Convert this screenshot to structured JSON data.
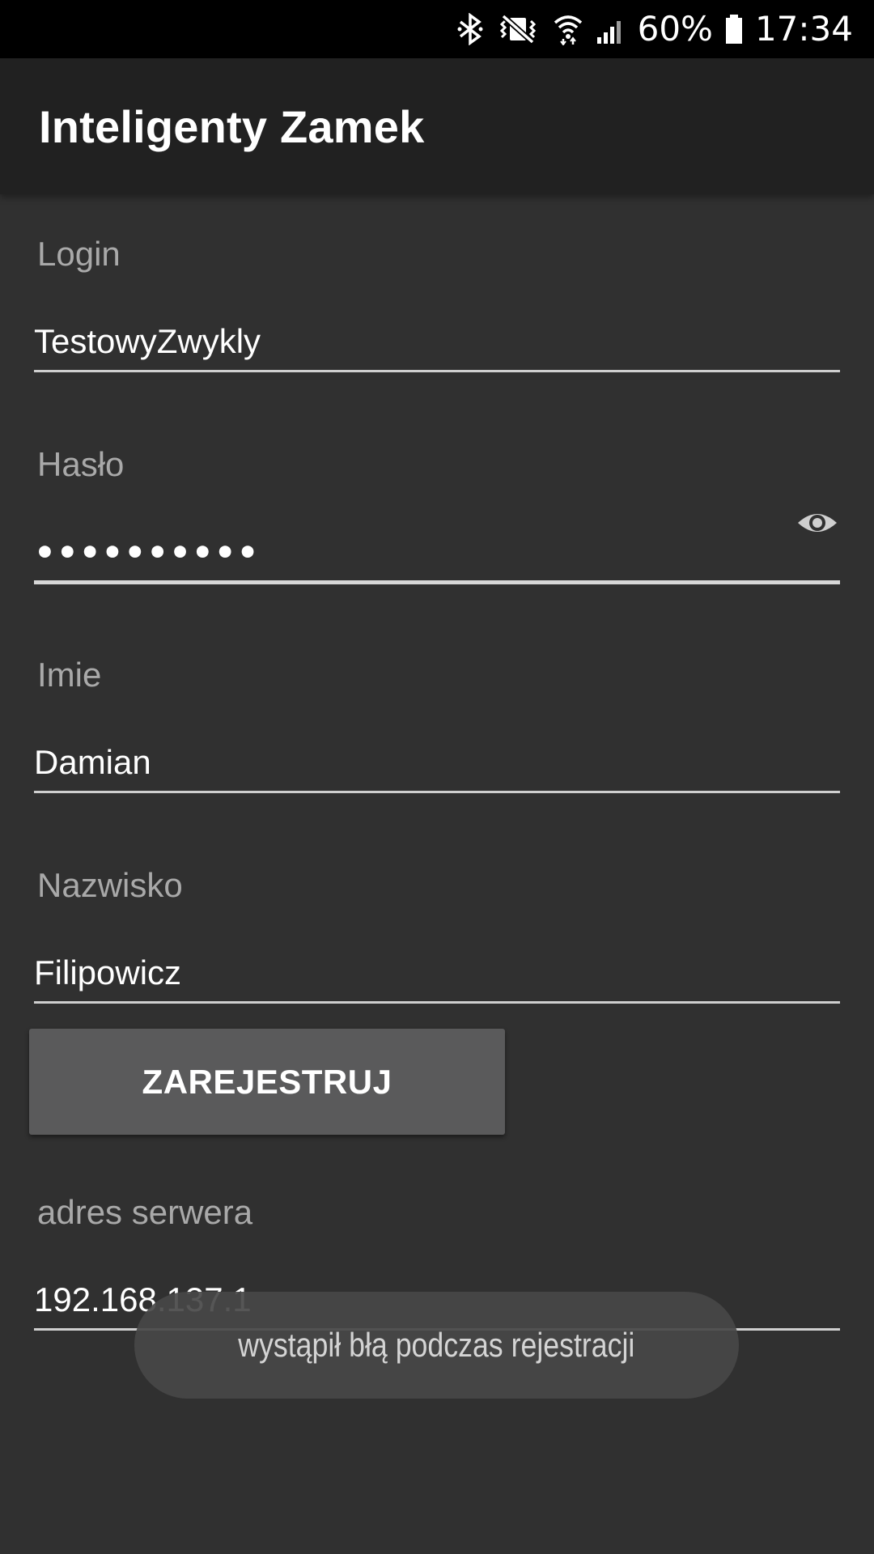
{
  "status_bar": {
    "battery_percent": "60%",
    "time": "17:34",
    "icons": [
      "bluetooth-icon",
      "vibrate-mute-icon",
      "wifi-icon",
      "signal-icon",
      "battery-icon"
    ]
  },
  "app_bar": {
    "title": "Inteligenty Zamek"
  },
  "form": {
    "login": {
      "label": "Login",
      "value": "TestowyZwykly"
    },
    "password": {
      "label": "Hasło",
      "masked_value": "••••••••••",
      "toggle_icon": "eye-icon"
    },
    "first_name": {
      "label": "Imie",
      "value": "Damian"
    },
    "last_name": {
      "label": "Nazwisko",
      "value": "Filipowicz"
    },
    "register_button": "ZAREJESTRUJ",
    "server_address": {
      "label": "adres serwera",
      "value": "192.168.137.1"
    }
  },
  "toast": {
    "message": "wystąpił błą podczas rejestracji"
  },
  "colors": {
    "background": "#303030",
    "app_bar": "#212121",
    "status_bar": "#000000",
    "button": "#5a5a5b",
    "label": "#a9a9a9",
    "text": "#ffffff"
  }
}
